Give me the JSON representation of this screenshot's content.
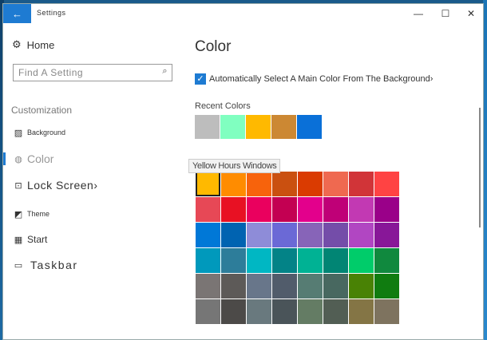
{
  "window": {
    "title": "Settings",
    "back_icon": "←",
    "minimize_icon": "—",
    "maximize_icon": "☐",
    "close_icon": "✕"
  },
  "sidebar": {
    "home_icon": "⚙",
    "home_label": "Home",
    "search_placeholder": "Find A Setting",
    "search_icon": "⌕",
    "section_label": "Customization",
    "items": [
      {
        "label": "Background",
        "icon": "▨"
      },
      {
        "label": "Color",
        "icon": "◍"
      },
      {
        "label": "Lock Screen›",
        "icon": "⊡"
      },
      {
        "label": "Theme",
        "icon": "◩"
      },
      {
        "label": "Start",
        "icon": "▦"
      },
      {
        "label": "Taskbar",
        "icon": "▭"
      }
    ]
  },
  "main": {
    "title": "Color",
    "auto_color_label": "Automatically Select A Main Color From The Background›",
    "auto_color_checked": true,
    "check_mark": "✓",
    "recent_label": "Recent Colors",
    "recent_colors": [
      "#BDBDBD",
      "#80FFC0",
      "#FFB900",
      "#CC8833",
      "#0A70D8"
    ],
    "tooltip": "Yellow Hours Windows",
    "colors": [
      [
        "#FFB900",
        "#FF8C00",
        "#F7630C",
        "#CA5010",
        "#DA3B01",
        "#EF6950",
        "#D13438",
        "#FF4343"
      ],
      [
        "#E74856",
        "#E81123",
        "#EA005E",
        "#C30052",
        "#E3008C",
        "#BF0077",
        "#C239B3",
        "#9A0089"
      ],
      [
        "#0078D7",
        "#0063B1",
        "#8E8CD8",
        "#6B69D6",
        "#8764B8",
        "#744DA9",
        "#B146C2",
        "#881798"
      ],
      [
        "#0099BC",
        "#2D7D9A",
        "#00B7C3",
        "#038387",
        "#00B294",
        "#018574",
        "#00CC6A",
        "#10893E"
      ],
      [
        "#7A7574",
        "#5D5A58",
        "#68768A",
        "#515C6B",
        "#567C73",
        "#486860",
        "#498205",
        "#107C10"
      ],
      [
        "#767676",
        "#4C4A48",
        "#69797E",
        "#4A5459",
        "#647C64",
        "#525E54",
        "#847545",
        "#7E735F"
      ]
    ]
  }
}
